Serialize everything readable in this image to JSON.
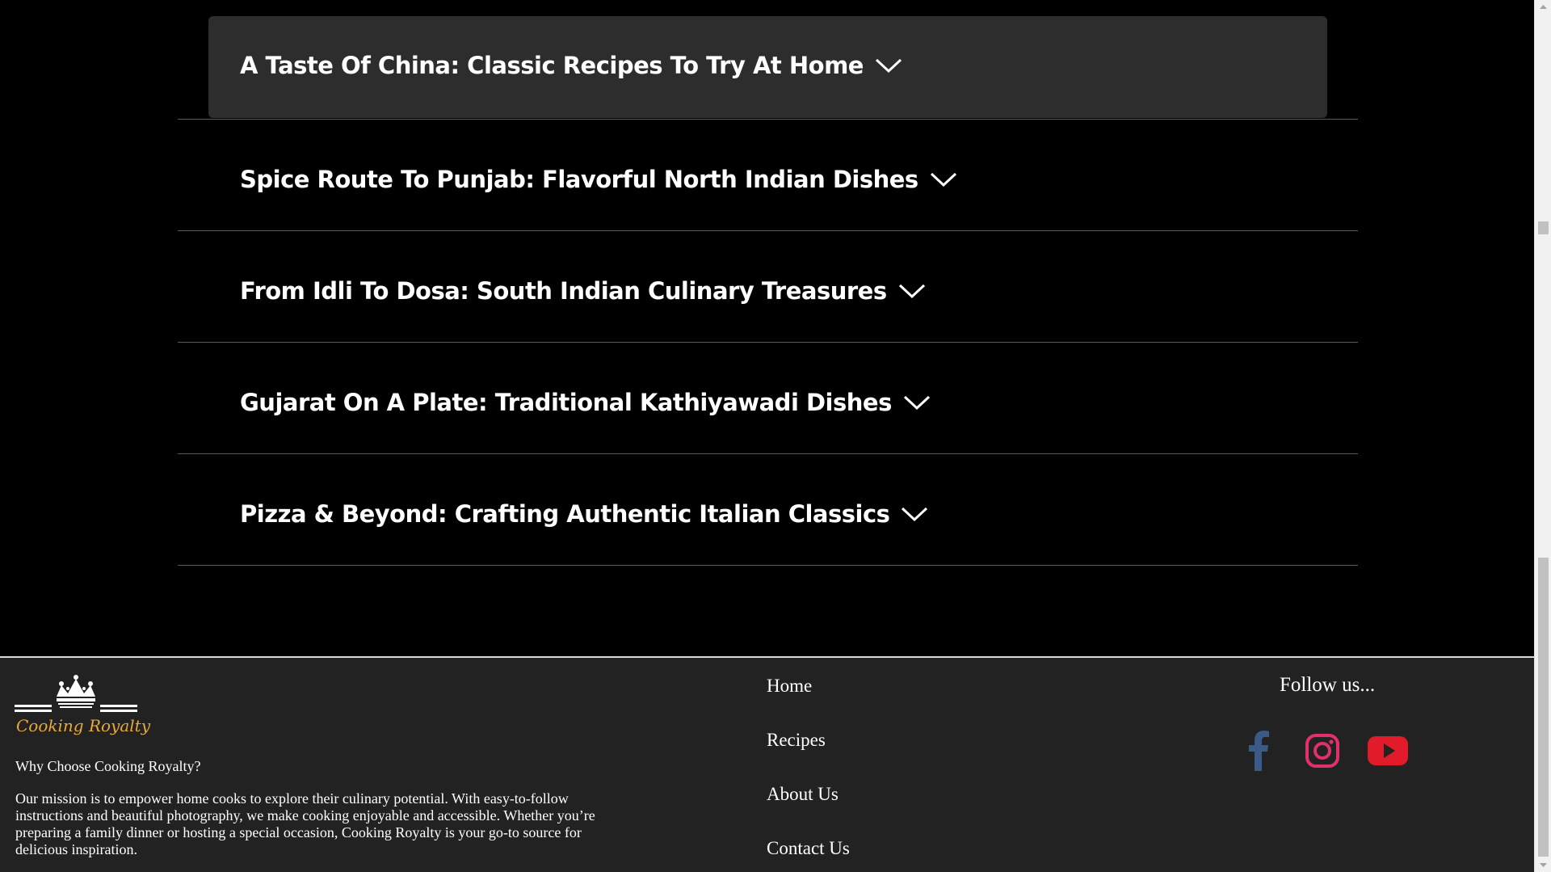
{
  "accordion": {
    "items": [
      {
        "title": "A Taste Of China: Classic Recipes To Try At Home"
      },
      {
        "title": "Spice Route To Punjab: Flavorful North Indian Dishes"
      },
      {
        "title": "From Idli To Dosa: South Indian Culinary Treasures"
      },
      {
        "title": "Gujarat On A Plate: Traditional Kathiyawadi Dishes"
      },
      {
        "title": "Pizza & Beyond: Crafting Authentic Italian Classics"
      }
    ]
  },
  "footer": {
    "logo_text": "Cooking Royalty",
    "why_title": "Why Choose Cooking Royalty?",
    "mission": "Our mission is to empower home cooks to explore their culinary potential. With easy-to-follow instructions and beautiful photography, we make cooking enjoyable and accessible. Whether you’re preparing a family dinner or hosting a special occasion, Cooking Royalty is your go-to source for delicious inspiration.",
    "nav": {
      "home": "Home",
      "recipes": "Recipes",
      "about": "About Us",
      "contact": "Contact Us"
    },
    "follow_label": "Follow us...",
    "social": {
      "facebook_icon": "facebook-icon",
      "instagram_icon": "instagram-icon",
      "youtube_icon": "youtube-icon"
    }
  },
  "colors": {
    "background": "#000000",
    "active_item_bg": "#2d2d2d",
    "footer_bg": "#222222",
    "logo_accent": "#e8a93a",
    "facebook": "#3b5a88",
    "instagram": "#e1306c",
    "youtube": "#e21b2a"
  }
}
